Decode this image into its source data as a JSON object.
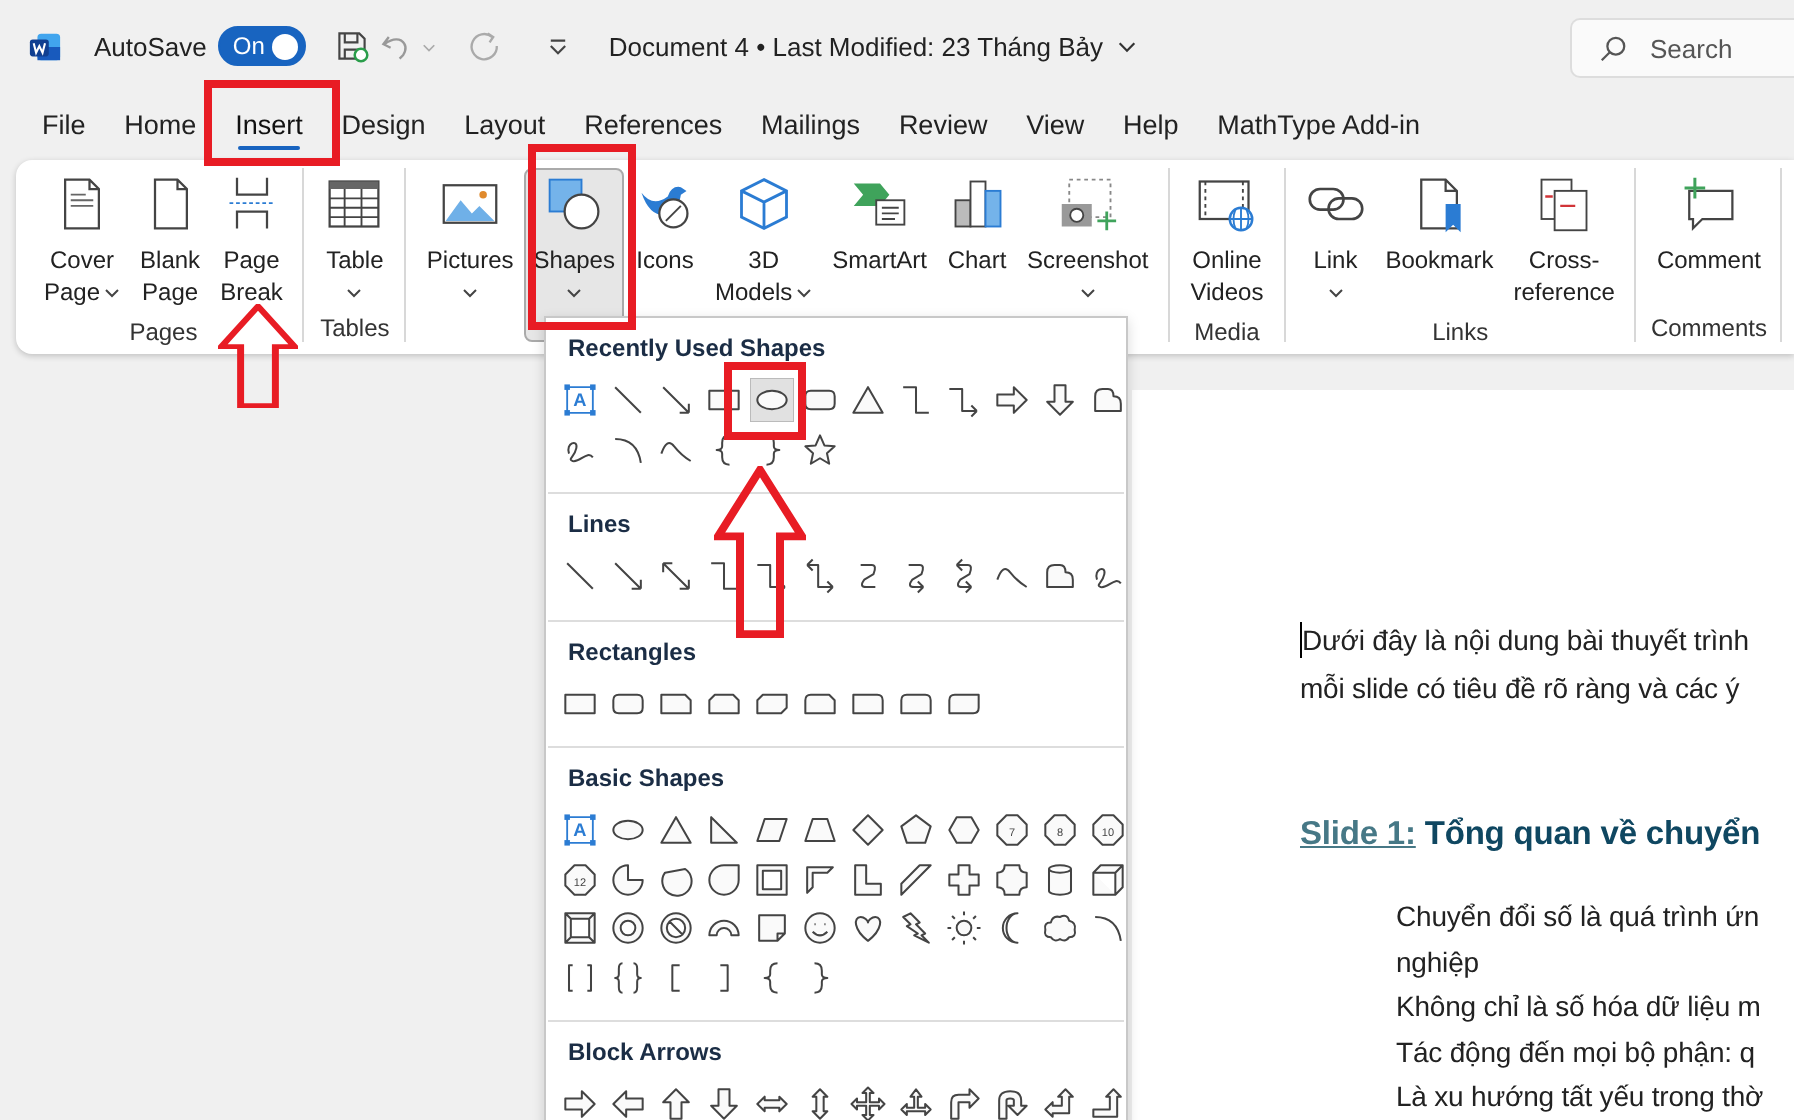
{
  "title_bar": {
    "autosave_label": "AutoSave",
    "autosave": {
      "label": "On",
      "on": true
    },
    "document_title": "Document 4 • Last Modified: 23 Tháng Bảy",
    "search": {
      "placeholder": "Search"
    }
  },
  "tabs": [
    {
      "label": "File",
      "selected": false
    },
    {
      "label": "Home",
      "selected": false
    },
    {
      "label": "Insert",
      "selected": true
    },
    {
      "label": "Design",
      "selected": false
    },
    {
      "label": "Layout",
      "selected": false
    },
    {
      "label": "References",
      "selected": false
    },
    {
      "label": "Mailings",
      "selected": false
    },
    {
      "label": "Review",
      "selected": false
    },
    {
      "label": "View",
      "selected": false
    },
    {
      "label": "Help",
      "selected": false
    },
    {
      "label": "MathType Add-in",
      "selected": false
    }
  ],
  "ribbon": {
    "groups": [
      {
        "label": "Pages",
        "buttons": [
          {
            "lines": [
              "Cover",
              "Page"
            ],
            "dropdown": true,
            "pressed": false
          },
          {
            "lines": [
              "Blank",
              "Page"
            ],
            "dropdown": false,
            "pressed": false
          },
          {
            "lines": [
              "Page",
              "Break"
            ],
            "dropdown": false,
            "pressed": false
          }
        ]
      },
      {
        "label": "Tables",
        "buttons": [
          {
            "lines": [
              "Table"
            ],
            "dropdown": true,
            "pressed": false
          }
        ]
      },
      {
        "buttons": [
          {
            "lines": [
              "Pictures"
            ],
            "dropdown": true,
            "pressed": false
          },
          {
            "lines": [
              "Shapes"
            ],
            "dropdown": true,
            "pressed": true
          },
          {
            "lines": [
              "Icons"
            ],
            "dropdown": false,
            "pressed": false
          },
          {
            "lines": [
              "3D",
              "Models"
            ],
            "dropdown": true,
            "pressed": false
          },
          {
            "lines": [
              "SmartArt"
            ],
            "dropdown": false,
            "pressed": false
          },
          {
            "lines": [
              "Chart"
            ],
            "dropdown": false,
            "pressed": false
          },
          {
            "lines": [
              "Screenshot"
            ],
            "dropdown": true,
            "pressed": false
          }
        ]
      },
      {
        "label": "Media",
        "buttons": [
          {
            "lines": [
              "Online",
              "Videos"
            ],
            "dropdown": false,
            "pressed": false
          }
        ]
      },
      {
        "label": "Links",
        "buttons": [
          {
            "lines": [
              "Link"
            ],
            "dropdown": true,
            "pressed": false
          },
          {
            "lines": [
              "Bookmark"
            ],
            "dropdown": false,
            "pressed": false
          },
          {
            "lines": [
              "Cross-",
              "reference"
            ],
            "dropdown": false,
            "pressed": false
          }
        ]
      },
      {
        "label": "Comments",
        "buttons": [
          {
            "lines": [
              "Comment"
            ],
            "dropdown": false,
            "pressed": false
          }
        ]
      }
    ]
  },
  "shapes_menu": {
    "sections": [
      {
        "title": "Recently Used Shapes",
        "shapes": [
          {
            "kind": "textbox",
            "label": "A",
            "selected": false
          },
          {
            "kind": "line",
            "selected": false
          },
          {
            "kind": "arrow-line",
            "selected": false
          },
          {
            "kind": "rect",
            "selected": false
          },
          {
            "kind": "oval",
            "selected": true
          },
          {
            "kind": "rounded-rect",
            "selected": false
          },
          {
            "kind": "triangle",
            "selected": false
          },
          {
            "kind": "elbow",
            "selected": false
          },
          {
            "kind": "elbow-arrow",
            "selected": false
          },
          {
            "kind": "right-arrow",
            "selected": false
          },
          {
            "kind": "down-arrow",
            "selected": false
          },
          {
            "kind": "freeform",
            "selected": false
          },
          {
            "kind": "scribble",
            "selected": false
          },
          {
            "kind": "arc",
            "selected": false
          },
          {
            "kind": "curve",
            "selected": false
          },
          {
            "kind": "left-brace",
            "selected": false
          },
          {
            "kind": "right-brace",
            "selected": false
          },
          {
            "kind": "star",
            "selected": false
          }
        ]
      },
      {
        "title": "Lines",
        "shapes": [
          {
            "kind": "line",
            "selected": false
          },
          {
            "kind": "arrow-line",
            "selected": false
          },
          {
            "kind": "double-arrow-line",
            "selected": false
          },
          {
            "kind": "elbow",
            "selected": false
          },
          {
            "kind": "elbow-arrow",
            "selected": false
          },
          {
            "kind": "elbow-double-arrow",
            "selected": false
          },
          {
            "kind": "curve-connector",
            "selected": false
          },
          {
            "kind": "curve-arrow",
            "selected": false
          },
          {
            "kind": "curve-double-arrow",
            "selected": false
          },
          {
            "kind": "curve",
            "selected": false
          },
          {
            "kind": "freeform",
            "selected": false
          },
          {
            "kind": "scribble",
            "selected": false
          }
        ]
      },
      {
        "title": "Rectangles",
        "shapes": [
          {
            "kind": "rect",
            "selected": false
          },
          {
            "kind": "rounded-rect",
            "selected": false
          },
          {
            "kind": "snip1",
            "selected": false
          },
          {
            "kind": "snip2",
            "selected": false
          },
          {
            "kind": "snip-diag",
            "selected": false
          },
          {
            "kind": "snip-round",
            "selected": false
          },
          {
            "kind": "round1",
            "selected": false
          },
          {
            "kind": "round2",
            "selected": false
          },
          {
            "kind": "round-diag",
            "selected": false
          }
        ]
      },
      {
        "title": "Basic Shapes",
        "shapes": [
          {
            "kind": "textbox",
            "label": "A",
            "selected": false
          },
          {
            "kind": "oval",
            "selected": false
          },
          {
            "kind": "triangle",
            "selected": false
          },
          {
            "kind": "right-triangle",
            "selected": false
          },
          {
            "kind": "parallelogram",
            "selected": false
          },
          {
            "kind": "trapezoid",
            "selected": false
          },
          {
            "kind": "diamond",
            "selected": false
          },
          {
            "kind": "pentagon",
            "selected": false
          },
          {
            "kind": "hexagon",
            "selected": false
          },
          {
            "kind": "polygon",
            "label": "7",
            "selected": false
          },
          {
            "kind": "polygon",
            "label": "8",
            "selected": false
          },
          {
            "kind": "polygon",
            "label": "10",
            "selected": false
          },
          {
            "kind": "polygon",
            "label": "12",
            "selected": false
          },
          {
            "kind": "pie",
            "selected": false
          },
          {
            "kind": "chord",
            "selected": false
          },
          {
            "kind": "teardrop",
            "selected": false
          },
          {
            "kind": "frame",
            "selected": false
          },
          {
            "kind": "half-frame",
            "selected": false
          },
          {
            "kind": "l-shape",
            "selected": false
          },
          {
            "kind": "diagonal-stripe",
            "selected": false
          },
          {
            "kind": "cross",
            "selected": false
          },
          {
            "kind": "plaque",
            "selected": false
          },
          {
            "kind": "can",
            "selected": false
          },
          {
            "kind": "cube",
            "selected": false
          },
          {
            "kind": "bevel",
            "selected": false
          },
          {
            "kind": "donut",
            "selected": false
          },
          {
            "kind": "no-symbol",
            "selected": false
          },
          {
            "kind": "block-arc",
            "selected": false
          },
          {
            "kind": "folded-corner",
            "selected": false
          },
          {
            "kind": "smiley",
            "selected": false
          },
          {
            "kind": "heart",
            "selected": false
          },
          {
            "kind": "lightning",
            "selected": false
          },
          {
            "kind": "sun",
            "selected": false
          },
          {
            "kind": "moon",
            "selected": false
          },
          {
            "kind": "cloud",
            "selected": false
          },
          {
            "kind": "arc",
            "selected": false
          },
          {
            "kind": "double-bracket",
            "selected": false
          },
          {
            "kind": "double-brace",
            "selected": false
          },
          {
            "kind": "left-bracket",
            "selected": false
          },
          {
            "kind": "right-bracket",
            "selected": false
          },
          {
            "kind": "left-brace",
            "selected": false
          },
          {
            "kind": "right-brace",
            "selected": false
          }
        ]
      },
      {
        "title": "Block Arrows",
        "shapes": [
          {
            "kind": "right-arrow",
            "selected": false
          },
          {
            "kind": "left-arrow",
            "selected": false
          },
          {
            "kind": "up-arrow",
            "selected": false
          },
          {
            "kind": "down-arrow",
            "selected": false
          },
          {
            "kind": "left-right-arrow",
            "selected": false
          },
          {
            "kind": "up-down-arrow",
            "selected": false
          },
          {
            "kind": "quad-arrow",
            "selected": false
          },
          {
            "kind": "left-right-up-arrow",
            "selected": false
          },
          {
            "kind": "bent-arrow",
            "selected": false
          },
          {
            "kind": "u-turn-arrow",
            "selected": false
          },
          {
            "kind": "left-up-arrow",
            "selected": false
          },
          {
            "kind": "bent-up-arrow",
            "selected": false
          }
        ]
      }
    ]
  },
  "document": {
    "intro": [
      "Dưới đây là nội dung bài thuyết trình",
      "mỗi slide có tiêu đề rõ ràng và các ý"
    ],
    "heading": {
      "label": "Slide 1:",
      "text": "Tổng quan về chuyển"
    },
    "body_lines": [
      "Chuyển đổi số là quá trình ứn",
      "nghiệp",
      "Không chỉ là số hóa dữ liệu m",
      "Tác động đến mọi bộ phận: q",
      "Là xu hướng tất yếu trong thờ"
    ]
  },
  "annotations": [
    {
      "kind": "box"
    },
    {
      "kind": "box"
    },
    {
      "kind": "box"
    },
    {
      "kind": "arrow"
    },
    {
      "kind": "arrow"
    }
  ]
}
